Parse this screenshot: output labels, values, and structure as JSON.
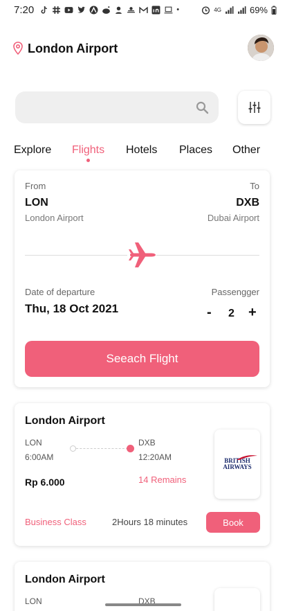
{
  "status_bar": {
    "time": "7:20",
    "battery": "69%",
    "network": "4G"
  },
  "header": {
    "location": "London Airport"
  },
  "search": {
    "placeholder": ""
  },
  "tabs": [
    "Explore",
    "Flights",
    "Hotels",
    "Places",
    "Other"
  ],
  "active_tab": "Flights",
  "flight_search": {
    "from_label": "From",
    "to_label": "To",
    "from_code": "LON",
    "to_code": "DXB",
    "from_name": "London Airport",
    "to_name": "Dubai Airport",
    "date_label": "Date of departure",
    "date_value": "Thu, 18 Oct 2021",
    "passenger_label": "Passengger",
    "passenger_minus": "-",
    "passenger_count": "2",
    "passenger_plus": "+",
    "search_button": "Seeach Flight"
  },
  "results": [
    {
      "title": "London Airport",
      "from_code": "LON",
      "to_code": "DXB",
      "depart_time": "6:00AM",
      "arrive_time": "12:20AM",
      "price": "Rp 6.000",
      "remains": "14 Remains",
      "airline_line1": "BRITISH",
      "airline_line2": "AIRWAYS",
      "class": "Business Class",
      "duration": "2Hours 18 minutes",
      "book_label": "Book"
    },
    {
      "title": "London Airport",
      "from_code": "LON",
      "to_code": "DXB"
    }
  ],
  "colors": {
    "accent": "#f0607a",
    "text": "#111111",
    "muted": "#777777"
  }
}
